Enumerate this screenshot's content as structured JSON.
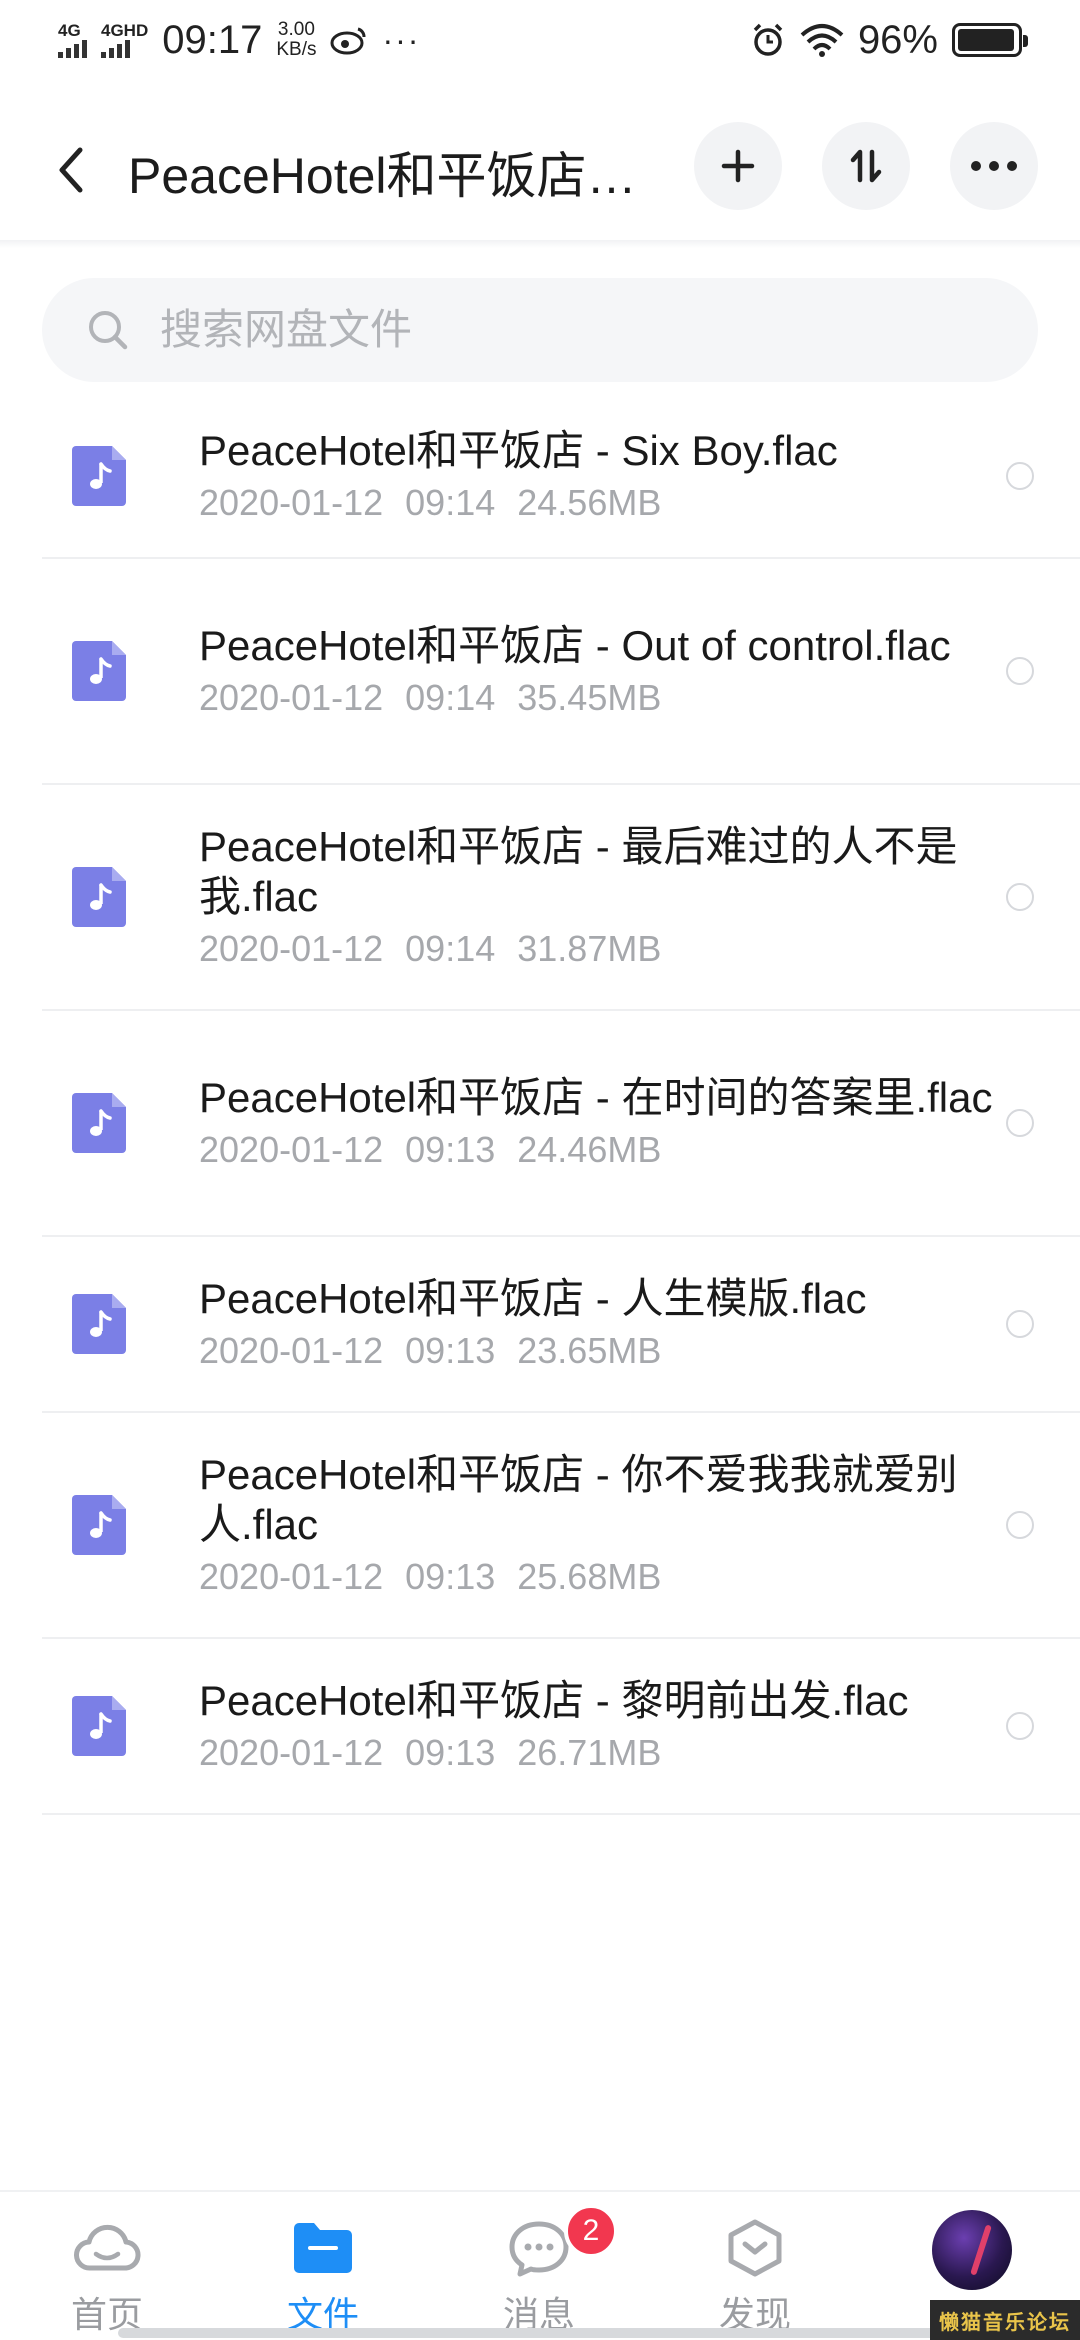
{
  "status_bar": {
    "signal1": "4G",
    "signal2": "4GHD",
    "time": "09:17",
    "speed_value": "3.00",
    "speed_unit": "KB/s",
    "dots": "···",
    "battery": "96%",
    "battery_level": 0.96
  },
  "header": {
    "title": "PeaceHotel和平饭店…"
  },
  "search": {
    "placeholder": "搜索网盘文件"
  },
  "files": [
    {
      "name": "PeaceHotel和平饭店 - Six Boy.flac",
      "date": "2020-01-12",
      "time": "09:14",
      "size": "24.56MB"
    },
    {
      "name": "PeaceHotel和平饭店 - Out of control.flac",
      "date": "2020-01-12",
      "time": "09:14",
      "size": "35.45MB"
    },
    {
      "name": "PeaceHotel和平饭店 - 最后难过的人不是我.flac",
      "date": "2020-01-12",
      "time": "09:14",
      "size": "31.87MB"
    },
    {
      "name": "PeaceHotel和平饭店 - 在时间的答案里.flac",
      "date": "2020-01-12",
      "time": "09:13",
      "size": "24.46MB"
    },
    {
      "name": "PeaceHotel和平饭店 - 人生模版.flac",
      "date": "2020-01-12",
      "time": "09:13",
      "size": "23.65MB"
    },
    {
      "name": "PeaceHotel和平饭店 - 你不爱我我就爱别人.flac",
      "date": "2020-01-12",
      "time": "09:13",
      "size": "25.68MB"
    },
    {
      "name": "PeaceHotel和平饭店 - 黎明前出发.flac",
      "date": "2020-01-12",
      "time": "09:13",
      "size": "26.71MB"
    }
  ],
  "nav": {
    "home": "首页",
    "files": "文件",
    "messages": "消息",
    "messages_badge": "2",
    "discover": "发现"
  },
  "watermark": "懒猫音乐论坛",
  "colors": {
    "accent": "#1e8ef6",
    "file_icon": "#7b7fe6",
    "badge": "#f2374f"
  }
}
